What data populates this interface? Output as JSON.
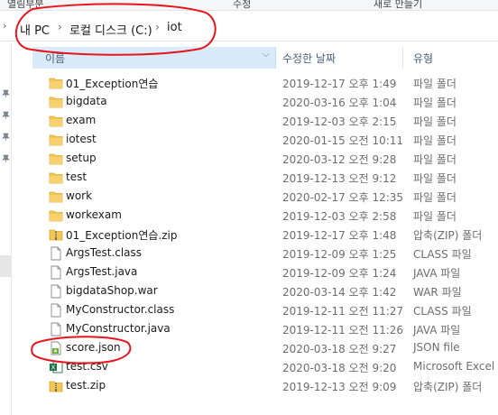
{
  "ribbon": {
    "items": [
      "열림부분",
      "수정",
      "새로 만들기"
    ]
  },
  "address": {
    "crumbs": [
      "내 PC",
      "로컬 디스크 (C:)",
      "iot"
    ]
  },
  "columns": {
    "name": "이름",
    "date": "수정한 날짜",
    "type": "유형"
  },
  "files": [
    {
      "name": "01_Exception연습",
      "date": "2019-12-17 오후 1:49",
      "type": "파일 폴더",
      "icon": "folder-icon"
    },
    {
      "name": "bigdata",
      "date": "2020-03-16 오후 1:04",
      "type": "파일 폴더",
      "icon": "folder-icon"
    },
    {
      "name": "exam",
      "date": "2019-12-03 오후 2:15",
      "type": "파일 폴더",
      "icon": "folder-icon"
    },
    {
      "name": "iotest",
      "date": "2020-01-15 오전 10:11",
      "type": "파일 폴더",
      "icon": "folder-icon"
    },
    {
      "name": "setup",
      "date": "2020-03-12 오전 9:28",
      "type": "파일 폴더",
      "icon": "folder-icon"
    },
    {
      "name": "test",
      "date": "2019-12-13 오전 9:12",
      "type": "파일 폴더",
      "icon": "folder-icon"
    },
    {
      "name": "work",
      "date": "2020-02-17 오후 12:35",
      "type": "파일 폴더",
      "icon": "folder-icon"
    },
    {
      "name": "workexam",
      "date": "2019-12-03 오후 2:58",
      "type": "파일 폴더",
      "icon": "folder-icon"
    },
    {
      "name": "01_Exception연습.zip",
      "date": "2019-12-17 오후 1:48",
      "type": "압축(ZIP) 폴더",
      "icon": "zip-icon"
    },
    {
      "name": "ArgsTest.class",
      "date": "2019-12-09 오후 1:25",
      "type": "CLASS 파일",
      "icon": "document-icon"
    },
    {
      "name": "ArgsTest.java",
      "date": "2019-12-09 오후 1:24",
      "type": "JAVA 파일",
      "icon": "document-icon"
    },
    {
      "name": "bigdataShop.war",
      "date": "2020-03-14 오후 1:42",
      "type": "WAR 파일",
      "icon": "document-icon"
    },
    {
      "name": "MyConstructor.class",
      "date": "2019-12-11 오전 11:27",
      "type": "CLASS 파일",
      "icon": "document-icon"
    },
    {
      "name": "MyConstructor.java",
      "date": "2019-12-11 오전 11:26",
      "type": "JAVA 파일",
      "icon": "document-icon"
    },
    {
      "name": "score.json",
      "date": "2020-03-18 오전 9:27",
      "type": "JSON file",
      "icon": "json-file-icon"
    },
    {
      "name": "test.csv",
      "date": "2020-03-18 오전 9:20",
      "type": "Microsoft Excel ...",
      "icon": "excel-file-icon"
    },
    {
      "name": "test.zip",
      "date": "2019-12-13 오전 9:09",
      "type": "압축(ZIP) 폴더",
      "icon": "zip-icon"
    }
  ],
  "colors": {
    "header_selected": "#d9ebf9",
    "folder": "#f4c755",
    "annotation": "#e8141c"
  }
}
